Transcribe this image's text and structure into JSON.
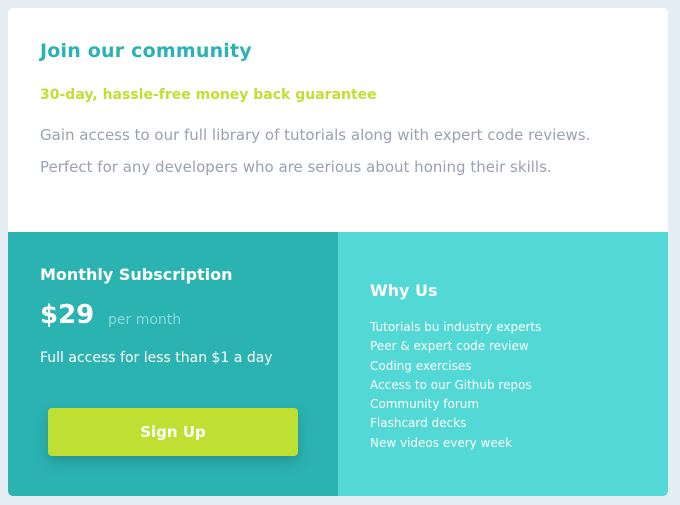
{
  "header": {
    "title": "Join our community",
    "guarantee": "30-day, hassle-free money back guarantee",
    "description_line1": "Gain access to our full library of tutorials along with expert code reviews.",
    "description_line2": "Perfect for any developers who are serious about honing their skills."
  },
  "subscription": {
    "title": "Monthly Subscription",
    "price": "$29",
    "period": "per month",
    "tagline": "Full access for less than $1 a day",
    "button_label": "Sign Up"
  },
  "why_us": {
    "title": "Why Us",
    "items": [
      "Tutorials bu industry experts",
      "Peer & expert code review",
      "Coding exercises",
      "Access to our Github repos",
      "Community forum",
      "Flashcard decks",
      "New videos every week"
    ]
  },
  "colors": {
    "page_background": "#e6eef5",
    "card_background": "#ffffff",
    "title_teal": "#2bb3b1",
    "guarantee_lime": "#bfdf32",
    "description_gray": "#9aa0b5",
    "subscription_panel": "#2bb3b1",
    "why_us_panel": "#52d8d5",
    "button_lime": "#bfe032"
  }
}
